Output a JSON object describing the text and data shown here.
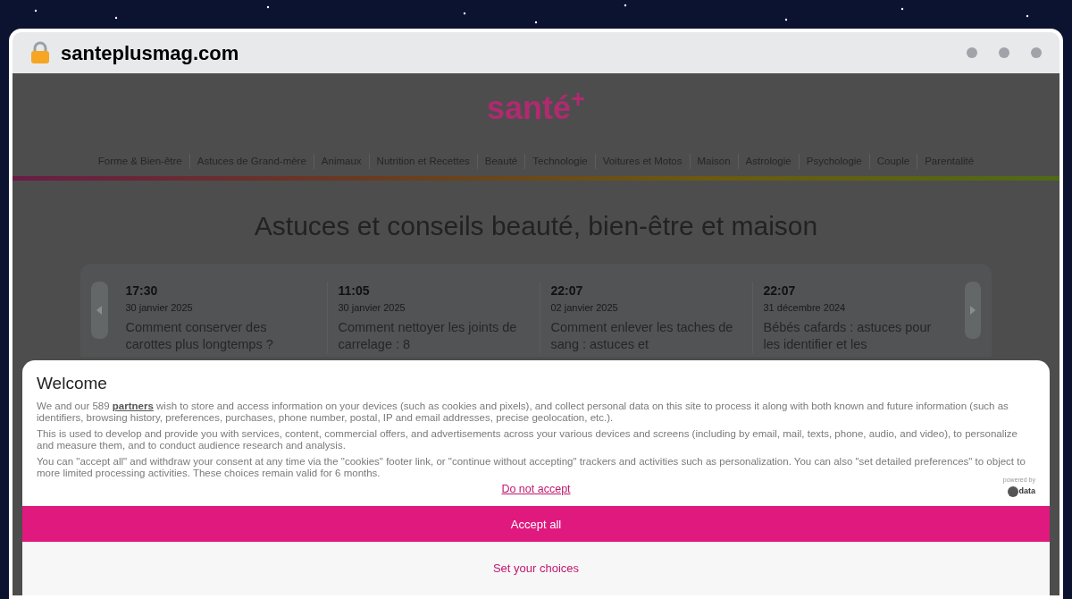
{
  "browser": {
    "address": "santeplusmag.com"
  },
  "site": {
    "logo": "santé$^{+}$",
    "nav": [
      "Forme & Bien-être",
      "Astuces de Grand-mère",
      "Animaux",
      "Nutrition et Recettes",
      "Beauté",
      "Technologie",
      "Voitures et Motos",
      "Maison",
      "Astrologie",
      "Psychologie",
      "Couple",
      "Parentalité"
    ],
    "heading": "Astuces et conseils beauté, bien-être et maison",
    "articles": [
      {
        "time": "17:30",
        "date": "30 janvier 2025",
        "title": "Comment conserver des carottes plus longtemps ?"
      },
      {
        "time": "11:05",
        "date": "30 janvier 2025",
        "title": "Comment nettoyer les joints de carrelage : 8"
      },
      {
        "time": "22:07",
        "date": "02 janvier 2025",
        "title": "Comment enlever les taches de sang : astuces et"
      },
      {
        "time": "22:07",
        "date": "31 décembre 2024",
        "title": "Bébés cafards : astuces pour les identifier et les"
      }
    ]
  },
  "consent": {
    "title": "Welcome",
    "paragraphs": [
      "We and our 589 **partners** wish to store and access information on your devices (such as cookies and pixels), and collect personal data on this site to process it along with both known and future information (such as identifiers, browsing history, preferences, purchases, phone number, postal, IP and email addresses, precise geolocation, etc.).",
      "This is used to develop and provide you with services, content, commercial offers, and advertisements across your various devices and screens (including by email, mail, texts, phone, audio, and video), to personalize and measure them, and to conduct audience research and analysis.",
      "You can \"accept all\" and withdraw your consent at any time via the \"cookies\" footer link, or \"continue without accepting\" trackers and activities such as personalization. You can also \"set detailed preferences\" to object to more limited processing activities. These choices remain valid for 6 months."
    ],
    "powered_by": "powered by",
    "provider": "data",
    "reject": "Do not accept",
    "accept": "Accept all",
    "settings": "Set your choices"
  }
}
